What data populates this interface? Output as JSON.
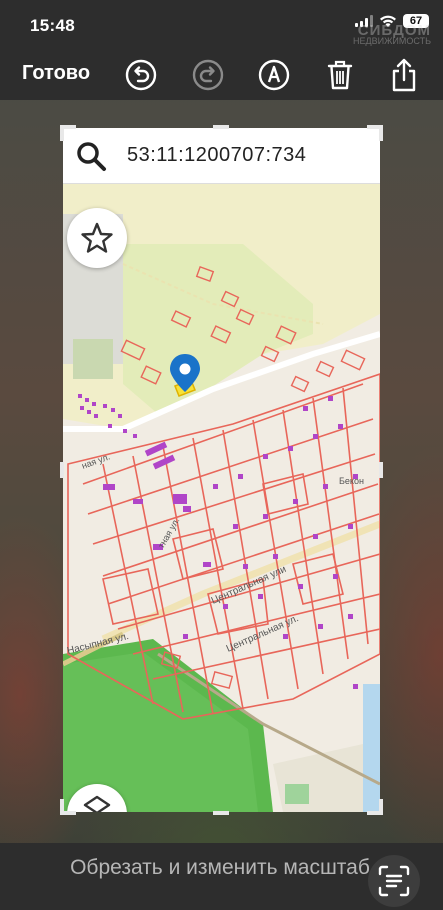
{
  "status": {
    "time": "15:48",
    "battery": "67"
  },
  "watermark": {
    "brand": "CИБДОМ",
    "subtitle": "НЕДВИЖИМОСТЬ"
  },
  "toolbar": {
    "done_label": "Готово",
    "icons": [
      "undo-icon",
      "redo-icon",
      "markup-pen-icon",
      "trash-icon",
      "share-icon"
    ]
  },
  "screenshot": {
    "search_text": "53:11:1200707:734",
    "map_labels": {
      "street_central": "Центральная ул.",
      "street_central_2": "Центральная ули",
      "street_side": "Бекон",
      "street_left": "ная ул.",
      "street_diag": "тная ул.",
      "street_bottom": "Насыпная ул."
    }
  },
  "bottom": {
    "crop_label": "Обрезать и изменить масштаб"
  },
  "colors": {
    "accent": "#1a73c9",
    "parcel": "#e8665a",
    "bar": "#2d2d2d"
  }
}
